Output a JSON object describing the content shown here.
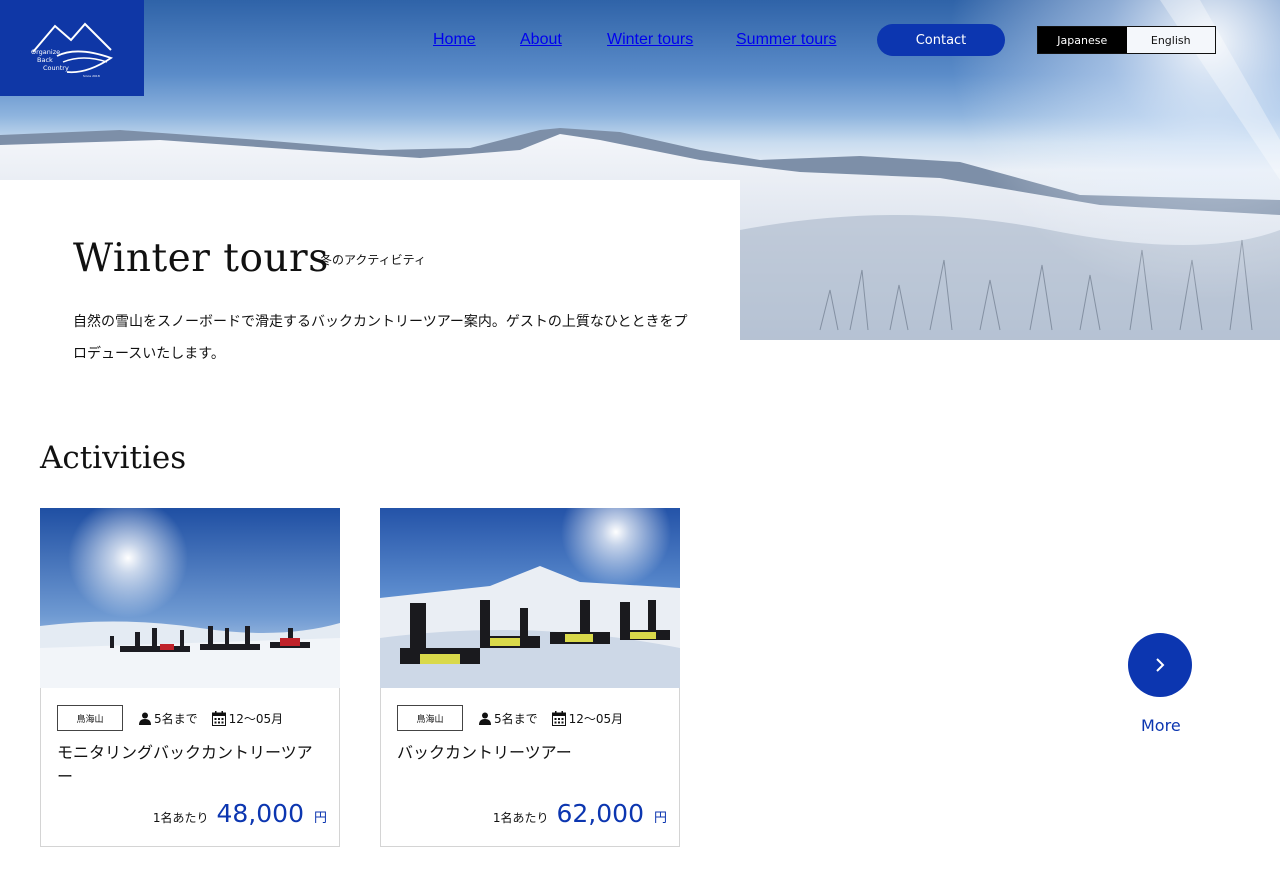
{
  "logo": {
    "line1": "Organize",
    "line2": "Back",
    "line3": "Country",
    "since": "Since 2018"
  },
  "nav": {
    "home": "Home",
    "about": "About",
    "winter": "Winter tours",
    "summer": "Summer tours",
    "contact": "Contact"
  },
  "lang": {
    "japanese": "Japanese",
    "english": "English",
    "active": "Japanese"
  },
  "intro": {
    "title": "Winter tours",
    "subtitle": "冬のアクティビティ",
    "description": "自然の雪山をスノーボードで滑走するバックカントリーツアー案内。ゲストの上質なひとときをプロデュースいたします。"
  },
  "activities": {
    "heading": "Activities",
    "cards": [
      {
        "tag": "鳥海山",
        "capacity": "5名まで",
        "season": "12〜05月",
        "title": "モニタリングバックカントリーツアー",
        "per": "1名あたり",
        "price": "48,000",
        "unit": "円"
      },
      {
        "tag": "鳥海山",
        "capacity": "5名まで",
        "season": "12〜05月",
        "title": "バックカントリーツアー",
        "per": "1名あたり",
        "price": "62,000",
        "unit": "円"
      }
    ],
    "more_label": "More"
  },
  "colors": {
    "brand": "#0c36b0",
    "logo_bg": "#0f37a6"
  },
  "icons": [
    "person-icon",
    "calendar-icon",
    "chevron-right-icon",
    "mountain-logo-icon"
  ]
}
